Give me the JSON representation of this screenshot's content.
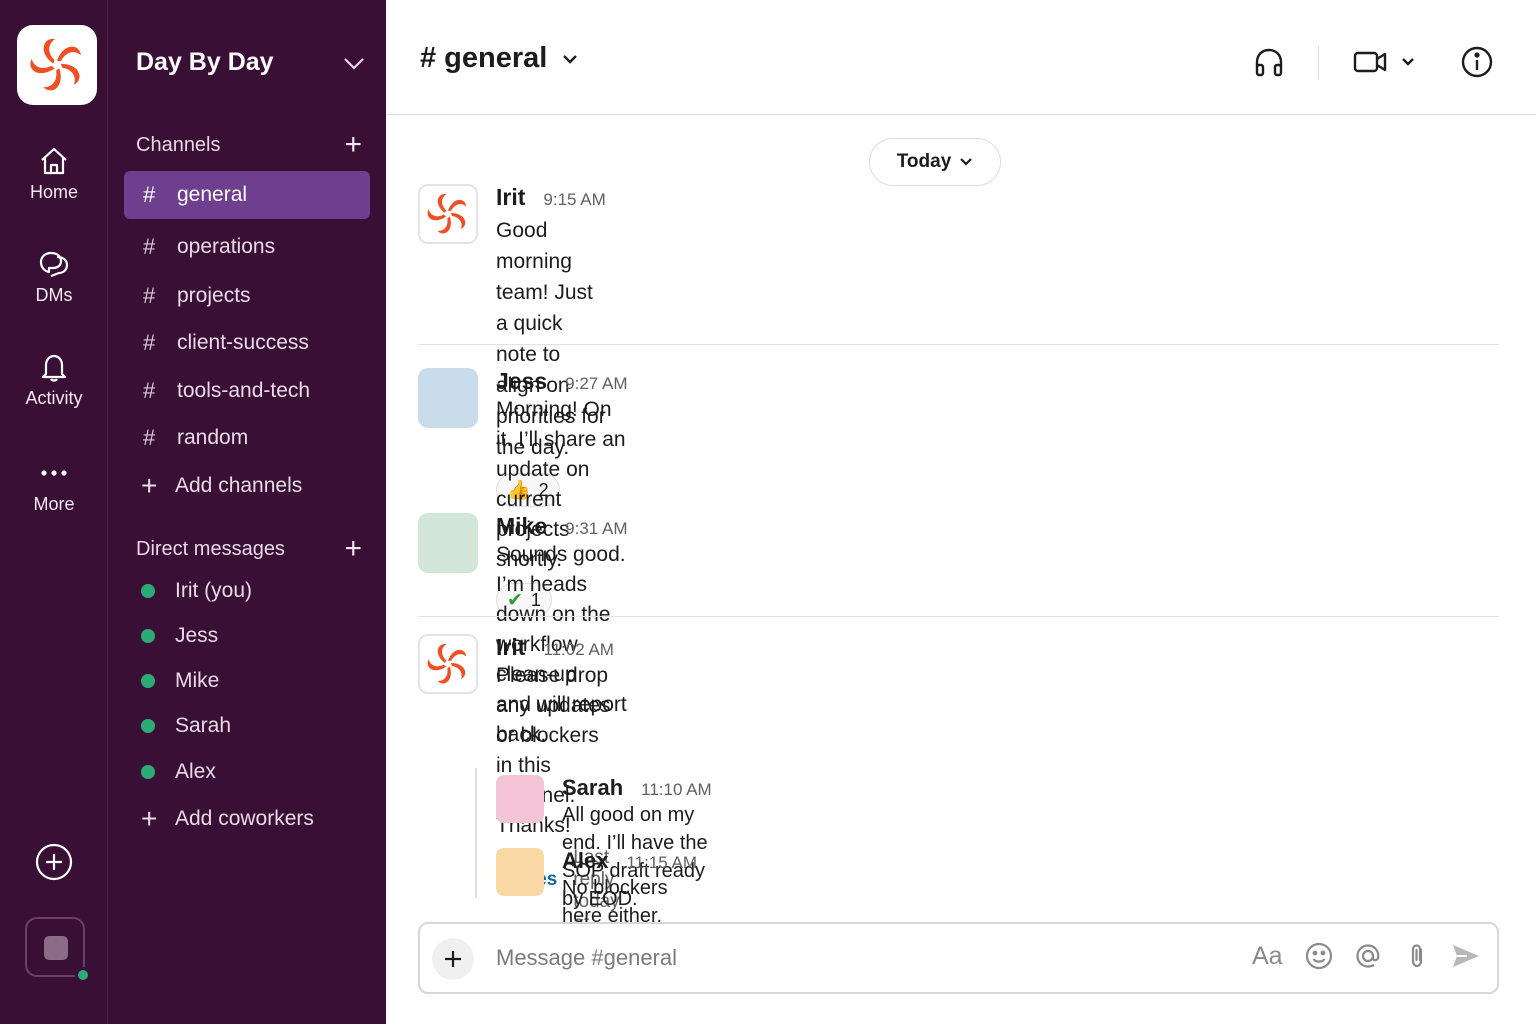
{
  "rail": {
    "home_label": "Home",
    "dms_label": "DMs",
    "activity_label": "Activity",
    "more_label": "More"
  },
  "workspace": {
    "name": "Day By Day"
  },
  "sidebar": {
    "channels_header": "Channels",
    "channels": [
      {
        "name": "general",
        "active": true
      },
      {
        "name": "operations"
      },
      {
        "name": "projects"
      },
      {
        "name": "client-success"
      },
      {
        "name": "tools-and-tech"
      },
      {
        "name": "random"
      }
    ],
    "add_channels_label": "Add channels",
    "dms_header": "Direct messages",
    "dms": [
      {
        "name": "Irit (you)"
      },
      {
        "name": "Jess"
      },
      {
        "name": "Mike"
      },
      {
        "name": "Sarah"
      },
      {
        "name": "Alex"
      }
    ],
    "add_coworkers_label": "Add coworkers",
    "hash_symbol": "#"
  },
  "header": {
    "channel_title": "# general"
  },
  "date_divider": {
    "label": "Today"
  },
  "messages": [
    {
      "author": "Irit",
      "time": "9:15 AM",
      "text_line1": "Good morning team! Just a quick note to",
      "text_line2": "align on priorities for the day.",
      "reaction": {
        "emoji": "👍",
        "count": "2"
      }
    },
    {
      "author": "Jess",
      "time": "9:27 AM",
      "text_line1": "Morning! On it. I’ll share an update on current projects",
      "text_line2": "shortly.",
      "reaction": {
        "emoji": "✔",
        "count": "1"
      }
    },
    {
      "author": "Mike",
      "time": "9:31 AM",
      "text_line1": "Sounds good. I’m heads down on the workflow clean-up",
      "text_line2": "and will report back."
    },
    {
      "author": "Irit",
      "time": "11:02 AM",
      "text_line1": "Please drop any updates or blockers in this channel.",
      "text_line2": "Thanks!",
      "replies_link": "2 replies",
      "last_reply": "Last reply today at 11:15 AM"
    }
  ],
  "thread_replies": [
    {
      "author": "Sarah",
      "time": "11:10 AM",
      "text": "All good on my end. I’ll have the SOP draft ready by EOD."
    },
    {
      "author": "Alex",
      "time": "11:15 AM",
      "text": "No blockers here either. Will share the doc once final."
    }
  ],
  "composer": {
    "placeholder": "Message #general",
    "format_label": "Aa"
  },
  "colors": {
    "sidebar_bg": "#3a0f36",
    "active_channel": "#6e3f8e",
    "presence": "#2bac76",
    "link": "#1264a3",
    "brand_logo": "#f04e23",
    "avatar_jess": "#c9dcec",
    "avatar_mike": "#d3e6da",
    "avatar_sarah": "#f2c4d6",
    "avatar_alex": "#fad8a6"
  },
  "icons": {
    "logo": "pinwheel-logo-icon",
    "home": "home-icon",
    "dms": "chat-bubbles-icon",
    "activity": "bell-icon",
    "more": "more-dots-icon",
    "headphones": "headphones-icon",
    "video": "video-camera-icon",
    "info": "info-icon"
  }
}
